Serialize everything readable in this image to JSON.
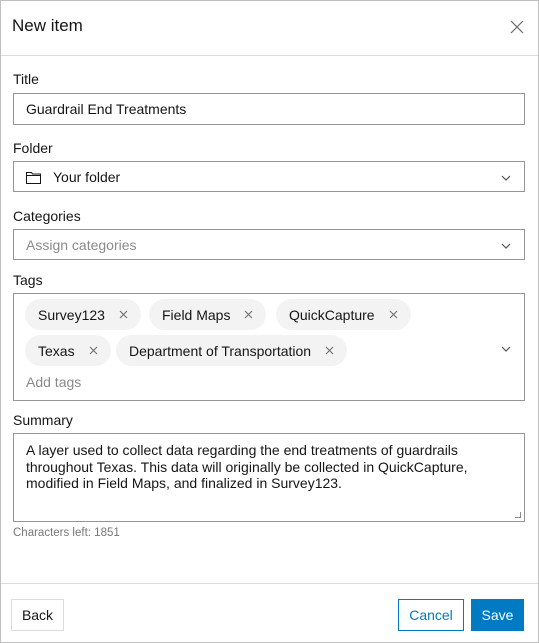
{
  "dialog": {
    "title": "New item",
    "close_icon": "close-icon"
  },
  "fields": {
    "title": {
      "label": "Title",
      "value": "Guardrail End Treatments"
    },
    "folder": {
      "label": "Folder",
      "value": "Your folder",
      "icon": "folder-icon"
    },
    "categories": {
      "label": "Categories",
      "placeholder": "Assign categories"
    },
    "tags": {
      "label": "Tags",
      "items": [
        "Survey123",
        "Field Maps",
        "QuickCapture",
        "Texas",
        "Department of Transportation"
      ],
      "placeholder": "Add tags"
    },
    "summary": {
      "label": "Summary",
      "value": "A layer used to collect data regarding the end treatments of guardrails throughout Texas. This data will originally be collected in QuickCapture, modified in Field Maps, and finalized in Survey123.",
      "chars_left": "Characters left: 1851"
    }
  },
  "footer": {
    "back_label": "Back",
    "cancel_label": "Cancel",
    "save_label": "Save"
  },
  "colors": {
    "accent": "#007ac2",
    "chip_bg": "#f3f3f3",
    "border": "#959595"
  }
}
